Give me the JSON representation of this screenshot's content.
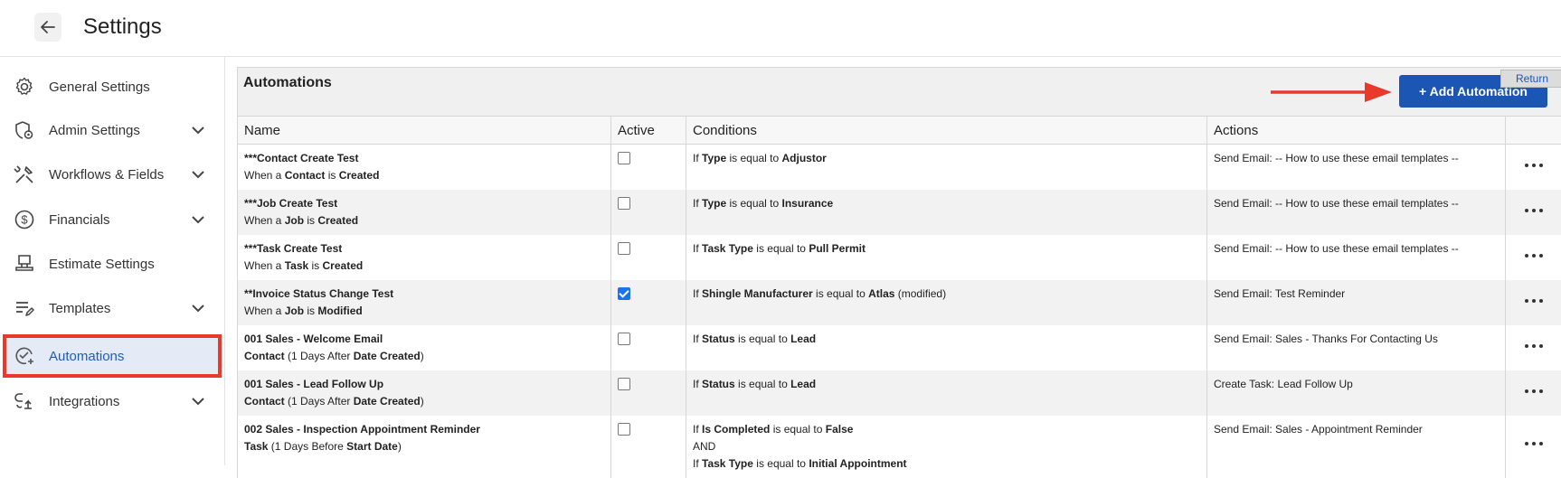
{
  "header": {
    "title": "Settings"
  },
  "sidebar": {
    "items": [
      {
        "label": "General Settings",
        "icon": "gear-icon"
      },
      {
        "label": "Admin Settings",
        "icon": "shield-gear-icon",
        "chevron": true
      },
      {
        "label": "Workflows & Fields",
        "icon": "tools-icon",
        "chevron": true
      },
      {
        "label": "Financials",
        "icon": "dollar-circle-icon",
        "chevron": true
      },
      {
        "label": "Estimate Settings",
        "icon": "stamp-icon"
      },
      {
        "label": "Templates",
        "icon": "edit-list-icon",
        "chevron": true
      },
      {
        "label": "Automations",
        "icon": "automation-icon",
        "active": true
      },
      {
        "label": "Integrations",
        "icon": "integrations-icon",
        "chevron": true
      }
    ]
  },
  "panel": {
    "title": "Automations",
    "add_button": "+ Add Automation",
    "return_button": "Return"
  },
  "table": {
    "headers": [
      "Name",
      "Active",
      "Conditions",
      "Actions",
      ""
    ],
    "rows": [
      {
        "name": "***Contact Create Test",
        "trigger": {
          "prefix": "When a ",
          "entity": "Contact",
          "mid": " is ",
          "event": "Created"
        },
        "active": false,
        "conditions": [
          {
            "field": "Type",
            "op": " is equal to ",
            "value": "Adjustor",
            "extra": ""
          }
        ],
        "action": "Send Email: -- How to use these email templates --"
      },
      {
        "name": "***Job Create Test",
        "trigger": {
          "prefix": "When a ",
          "entity": "Job",
          "mid": " is ",
          "event": "Created"
        },
        "active": false,
        "conditions": [
          {
            "field": "Type",
            "op": " is equal to ",
            "value": "Insurance",
            "extra": ""
          }
        ],
        "action": "Send Email: -- How to use these email templates --"
      },
      {
        "name": "***Task Create Test",
        "trigger": {
          "prefix": "When a ",
          "entity": "Task",
          "mid": " is ",
          "event": "Created"
        },
        "active": false,
        "conditions": [
          {
            "field": "Task Type",
            "op": " is equal to ",
            "value": "Pull Permit",
            "extra": ""
          }
        ],
        "action": "Send Email: -- How to use these email templates --"
      },
      {
        "name": "**Invoice Status Change Test",
        "trigger": {
          "prefix": "When a ",
          "entity": "Job",
          "mid": " is ",
          "event": "Modified"
        },
        "active": true,
        "conditions": [
          {
            "field": "Shingle Manufacturer",
            "op": " is equal to ",
            "value": "Atlas",
            "extra": " (modified)"
          }
        ],
        "action": "Send Email: Test Reminder"
      },
      {
        "name": "001 Sales - Welcome Email",
        "trigger": {
          "prefix": "",
          "entity": "Contact",
          "mid": " (1 Days After ",
          "event": "Date Created",
          "suffix": ")"
        },
        "active": false,
        "conditions": [
          {
            "field": "Status",
            "op": " is equal to ",
            "value": "Lead",
            "extra": ""
          }
        ],
        "action": "Send Email: Sales - Thanks For Contacting Us"
      },
      {
        "name": "001 Sales - Lead Follow Up",
        "trigger": {
          "prefix": "",
          "entity": "Contact",
          "mid": " (1 Days After ",
          "event": "Date Created",
          "suffix": ")"
        },
        "active": false,
        "conditions": [
          {
            "field": "Status",
            "op": " is equal to ",
            "value": "Lead",
            "extra": ""
          }
        ],
        "action": "Create Task: Lead Follow Up"
      },
      {
        "name": "002 Sales - Inspection Appointment Reminder",
        "trigger": {
          "prefix": "",
          "entity": "Task",
          "mid": " (1 Days Before ",
          "event": "Start Date",
          "suffix": ")"
        },
        "active": false,
        "conditions": [
          {
            "field": "Is Completed",
            "op": " is equal to ",
            "value": "False",
            "extra": ""
          },
          {
            "joiner": "AND"
          },
          {
            "field": "Task Type",
            "op": " is equal to ",
            "value": "Initial Appointment",
            "extra": ""
          }
        ],
        "action": "Send Email: Sales - Appointment Reminder"
      }
    ]
  },
  "colors": {
    "accent": "#1b56b4",
    "highlight_box": "#e8392b",
    "active_bg": "#e4ebf7"
  }
}
